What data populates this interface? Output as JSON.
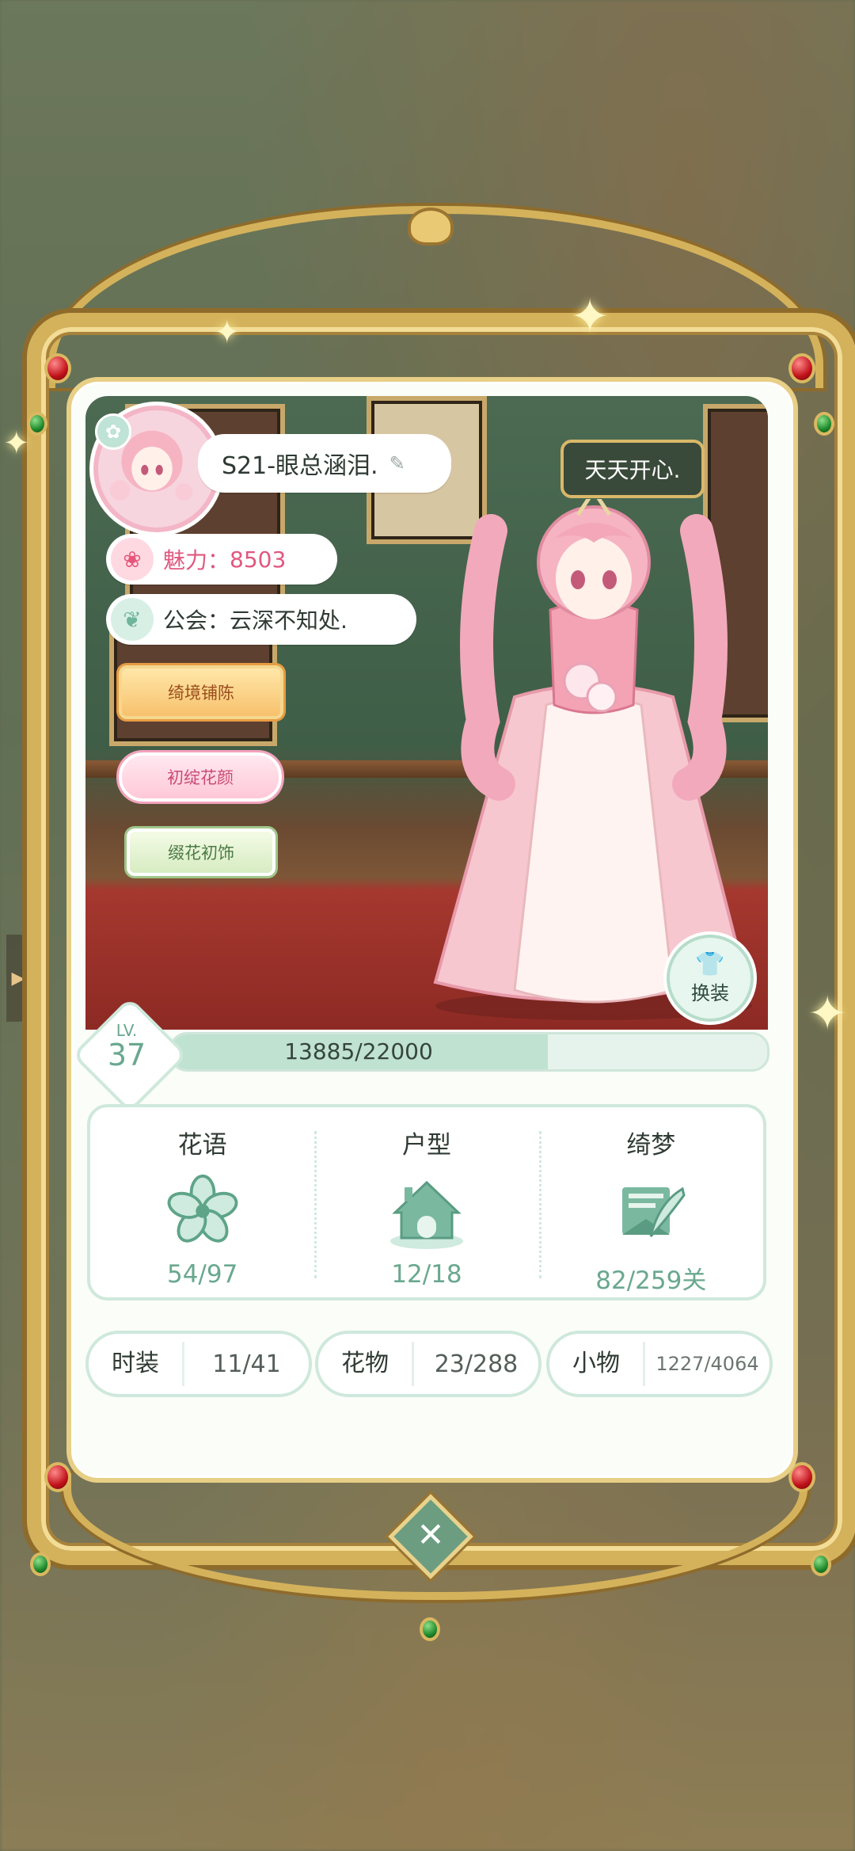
{
  "profile": {
    "name": "S21-眼总涵泪.",
    "charm_label": "魅力：",
    "charm_value": "8503",
    "guild_text": "公会：云深不知处.",
    "status_bubble": "天天开心."
  },
  "tags": [
    "绮境铺陈",
    "初绽花颜",
    "缀花初饰"
  ],
  "swap_button": "换装",
  "level": {
    "lv_label": "LV.",
    "lv_value": "37",
    "xp_text": "13885/22000",
    "xp_fraction": 0.631
  },
  "stats": [
    {
      "title": "花语",
      "value": "54/97",
      "icon": "flower-icon"
    },
    {
      "title": "户型",
      "value": "12/18",
      "icon": "house-icon"
    },
    {
      "title": "绮梦",
      "value": "82/259关",
      "icon": "letter-quill-icon"
    }
  ],
  "collections": [
    {
      "label": "时装",
      "value": "11/41"
    },
    {
      "label": "花物",
      "value": "23/288"
    },
    {
      "label": "小物",
      "value": "1227/4064"
    }
  ],
  "colors": {
    "accent_green": "#6aa88f",
    "charm_pink": "#e0587f",
    "frame_gold": "#d4b25b"
  }
}
